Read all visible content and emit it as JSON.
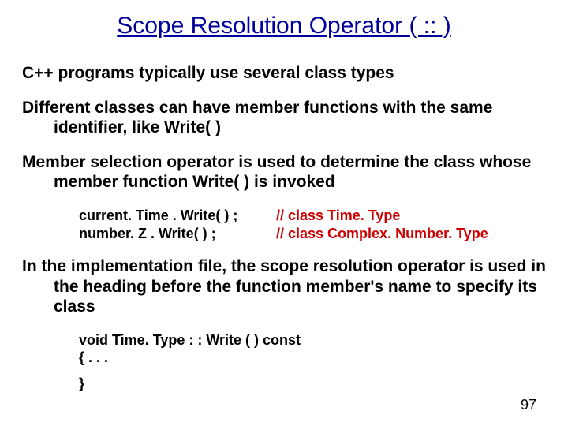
{
  "title": "Scope Resolution Operator ( :: )",
  "para1": "C++ programs typically use several class types",
  "para2": "Different classes can have member functions with the same identifier, like Write( )",
  "para3": "Member selection operator is used to determine the class whose member function Write( ) is invoked",
  "code1": {
    "line1_left": "current. Time . Write( ) ;",
    "line1_right": "// class Time. Type",
    "line2_left": "number. Z . Write( ) ;",
    "line2_right": "// class Complex. Number. Type"
  },
  "para4": "In the implementation file, the scope resolution operator is used in the heading before the function member's name to specify its class",
  "code2": {
    "line1": "void  Time. Type : : Write ( )   const",
    "line2": "{        .  .  .",
    "line3": "}"
  },
  "page_number": "97"
}
